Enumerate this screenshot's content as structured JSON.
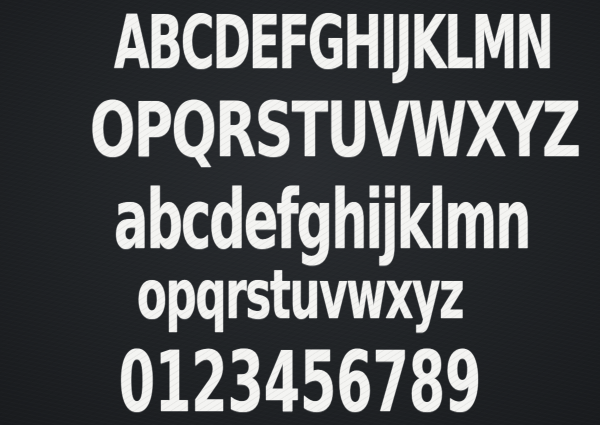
{
  "specimen": {
    "uppercase_line_1": "ABCDEFGHIJKLMN",
    "uppercase_line_2": "OPQRSTUVWXYZ",
    "lowercase_line_1": "abcdefghijklmn",
    "lowercase_line_2": "opqrstuvwxyz",
    "digits_line": "0123456789"
  },
  "colors": {
    "background": "#1e2124",
    "chalk": "#f4f4f2"
  }
}
